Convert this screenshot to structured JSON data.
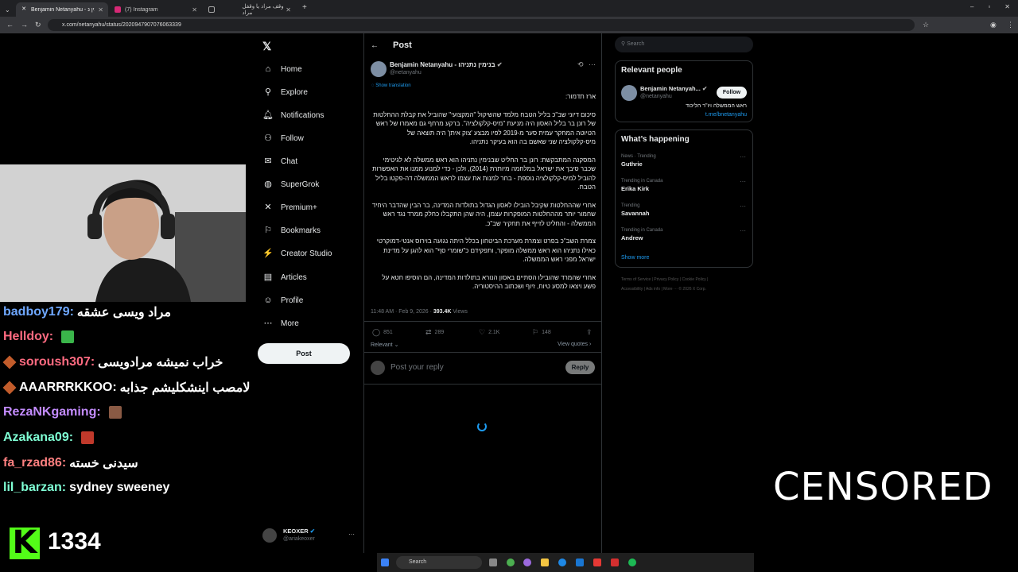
{
  "browser": {
    "tabs": [
      {
        "label": "Benjamin Netanyahu - בנימין נ",
        "icon": "x-logo-icon"
      },
      {
        "label": "(7) Instagram",
        "icon": "instagram-icon"
      },
      {
        "label": "وقف مراد یا وقفل مراد",
        "icon": "tab-icon"
      }
    ],
    "url": "x.com/netanyahu/status/2020947907076063339"
  },
  "chat": {
    "lines": [
      {
        "name": "badboy179:",
        "msg": "مراد ویسی عشقه",
        "color": "#6fa8ff",
        "badge": false
      },
      {
        "name": "Helldoy:",
        "msg": "",
        "color": "#ff6b81",
        "badge": false,
        "emote": "#3ab54a"
      },
      {
        "name": "soroush307:",
        "msg": "خراب نمیشه مرادویسی",
        "color": "#ff6b81",
        "badge": true
      },
      {
        "name": "AAARRRKKOO:",
        "msg": "لامصب اینشکلیشم جذابه",
        "color": "#ffffff",
        "badge": true
      },
      {
        "name": "RezaNKgaming:",
        "msg": "",
        "color": "#c48cff",
        "badge": false,
        "emote": "#8a5a44"
      },
      {
        "name": "Azakana09:",
        "msg": "",
        "color": "#7fffd4",
        "badge": false,
        "emote": "#c0392b"
      },
      {
        "name": "fa_rzad86:",
        "msg": "سیدنی خسته",
        "color": "#ff8080",
        "badge": false
      },
      {
        "name": "lil_barzan:",
        "msg": "sydney sweeney",
        "color": "#7fffd4",
        "badge": false
      }
    ]
  },
  "stream": {
    "viewers": "1334",
    "censored": "CENSORED"
  },
  "x_nav": {
    "items": [
      {
        "label": "Home",
        "icon": "home-icon",
        "glyph": "⌂"
      },
      {
        "label": "Explore",
        "icon": "search-icon",
        "glyph": "⚲"
      },
      {
        "label": "Notifications",
        "icon": "bell-icon",
        "glyph": "♫"
      },
      {
        "label": "Follow",
        "icon": "person-plus-icon",
        "glyph": "⚇"
      },
      {
        "label": "Chat",
        "icon": "mail-icon",
        "glyph": "✉"
      },
      {
        "label": "SuperGrok",
        "icon": "grok-icon",
        "glyph": "◍"
      },
      {
        "label": "Premium+",
        "icon": "x-logo-icon",
        "glyph": "✕"
      },
      {
        "label": "Bookmarks",
        "icon": "bookmark-icon",
        "glyph": "⚐"
      },
      {
        "label": "Creator Studio",
        "icon": "creator-icon",
        "glyph": "⚡"
      },
      {
        "label": "Articles",
        "icon": "article-icon",
        "glyph": "▤"
      },
      {
        "label": "Profile",
        "icon": "user-icon",
        "glyph": "☺"
      },
      {
        "label": "More",
        "icon": "more-icon",
        "glyph": "⋯"
      }
    ],
    "post_label": "Post",
    "account_name": "KEOXER",
    "account_handle": "@ariakeoxer"
  },
  "post": {
    "header": "Post",
    "author": "Benjamin Netanyahu - בנימין נתניהו",
    "handle": "@netanyahu",
    "show_translation": "Show translation",
    "paragraphs": [
      "ארז תדמור:",
      "סיכום דיוני שב\"כ בליל הטבח מלמד שהשיקול \"המקצועי\" שהוביל את קבלת ההחלטות של רונן בר בליל האסון היה מניעת \"מיס-קלקולציה\". ברקע מרחף גם מאמרו של ראש הטיוטה המחקר עמית סער מ-2019 לפיו מבצע 'צוק איתן' היה תוצאה של מיס-קלקולציה שני שאשם בה הוא בעיקר נתניהו.",
      "המסקנה המתבקשת: רונן בר החליט שבנימין נתניהו הוא ראש ממשלה לא לגיטימי שכבר סיבך את ישראל במלחמה מיותרת (2014), ולכן - כדי למנוע ממנו את האפשרות להוביל למיס-קלקולציה נוספת - בחר למנות את עצמו לראש הממשלה דה-פקטו בליל הטבח.",
      "אחרי שההחלטות שקיבל הובילו לאסון הגדול בתולדות המדינה, בר הבין שהדבר היחיד שחמור יותר מההחלטות המופקרות עצמן, היה שהן התקבלו כחלק ממרד נגד ראש הממשלה - והחליט לזייף את תחקיר שב\"כ.",
      "צמרת השב\"כ בפרט וצמרת מערכת הביטחון בכלל היתה נגועה בוירוס אנטי-דמוקרטי כאילו נתניהו הוא ראש ממשלה מופקר, ותפקידם כ\"שומרי סף\" הוא להגן על מדינת ישראל מפני ראש הממשלה.",
      "אחרי שהמרד שהובילו הסתיים באסון הנורא בתולדות המדינה, הם הוסיפו חטא על פשע ויצאו למסע טיוח, זיוף ושכתוב ההיסטוריה."
    ],
    "time": "11:48 AM · Feb 9, 2026 · ",
    "views": "393.4K",
    "views_label": " Views",
    "replies": "851",
    "reposts": "289",
    "likes": "2.1K",
    "bookmarks": "148",
    "relevant_label": "Relevant",
    "view_quotes": "View quotes",
    "reply_placeholder": "Post your reply",
    "reply_button": "Reply"
  },
  "right": {
    "search_placeholder": "Search",
    "relevant_title": "Relevant people",
    "person_name": "Benjamin Netanyah...",
    "person_handle": "@netanyahu",
    "follow_label": "Follow",
    "bio": "ראש הממשלה ויו\"ר הליכוד",
    "bio_link": "t.me/bnetanyahu",
    "happening_title": "What’s happening",
    "trends": [
      {
        "label": "News · Trending",
        "name": "Guthrie"
      },
      {
        "label": "Trending in Canada",
        "name": "Erika Kirk"
      },
      {
        "label": "Trending",
        "name": "Savannah"
      },
      {
        "label": "Trending in Canada",
        "name": "Andrew"
      }
    ],
    "show_more": "Show more",
    "footer1": "Terms of Service  |  Privacy Policy  |  Cookie Policy  |",
    "footer2": "Accessibility  |  Ads info  |  More ···  © 2026 X Corp."
  },
  "taskbar": {
    "search": "Search"
  },
  "colors": {
    "accent": "#1d9bf0",
    "kick": "#53fc18",
    "background": "#000000"
  }
}
